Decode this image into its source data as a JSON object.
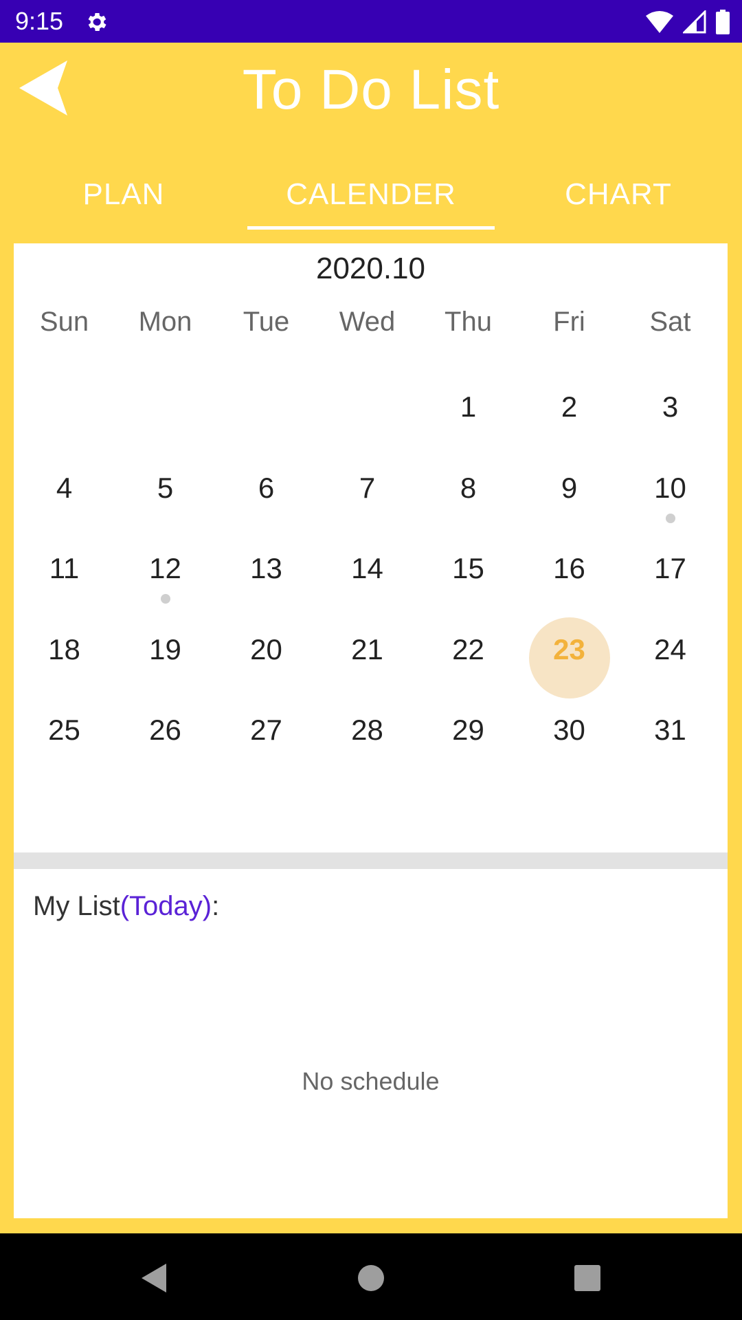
{
  "status_bar": {
    "time": "9:15",
    "icons": [
      "gear-icon",
      "wifi-icon",
      "signal-icon",
      "battery-icon"
    ],
    "background": "#3700b3"
  },
  "app_bar": {
    "title": "To Do List",
    "back_icon": "back-arrow-icon",
    "background": "#ffd84d"
  },
  "tabs": [
    {
      "label": "PLAN",
      "active": false
    },
    {
      "label": "CALENDER",
      "active": true
    },
    {
      "label": "CHART",
      "active": false
    }
  ],
  "calendar": {
    "month": "2020.10",
    "weekdays": [
      "Sun",
      "Mon",
      "Tue",
      "Wed",
      "Thu",
      "Fri",
      "Sat"
    ],
    "weeks": [
      [
        "",
        "",
        "",
        "",
        "1",
        "2",
        "3"
      ],
      [
        "4",
        "5",
        "6",
        "7",
        "8",
        "9",
        "10"
      ],
      [
        "11",
        "12",
        "13",
        "14",
        "15",
        "16",
        "17"
      ],
      [
        "18",
        "19",
        "20",
        "21",
        "22",
        "23",
        "24"
      ],
      [
        "25",
        "26",
        "27",
        "28",
        "29",
        "30",
        "31"
      ]
    ],
    "selected_day": "23",
    "days_with_events": [
      "10",
      "12"
    ],
    "selected_color": "#f3b23b",
    "selected_bg": "#f7e4c5"
  },
  "my_list": {
    "label_prefix": "My List",
    "label_open": "(",
    "label_today": "Today",
    "label_close": "):",
    "empty_text": "No schedule",
    "today_color": "#5a22d6"
  },
  "nav_bar": {
    "icons": [
      "back-triangle-icon",
      "home-circle-icon",
      "recents-square-icon"
    ]
  }
}
